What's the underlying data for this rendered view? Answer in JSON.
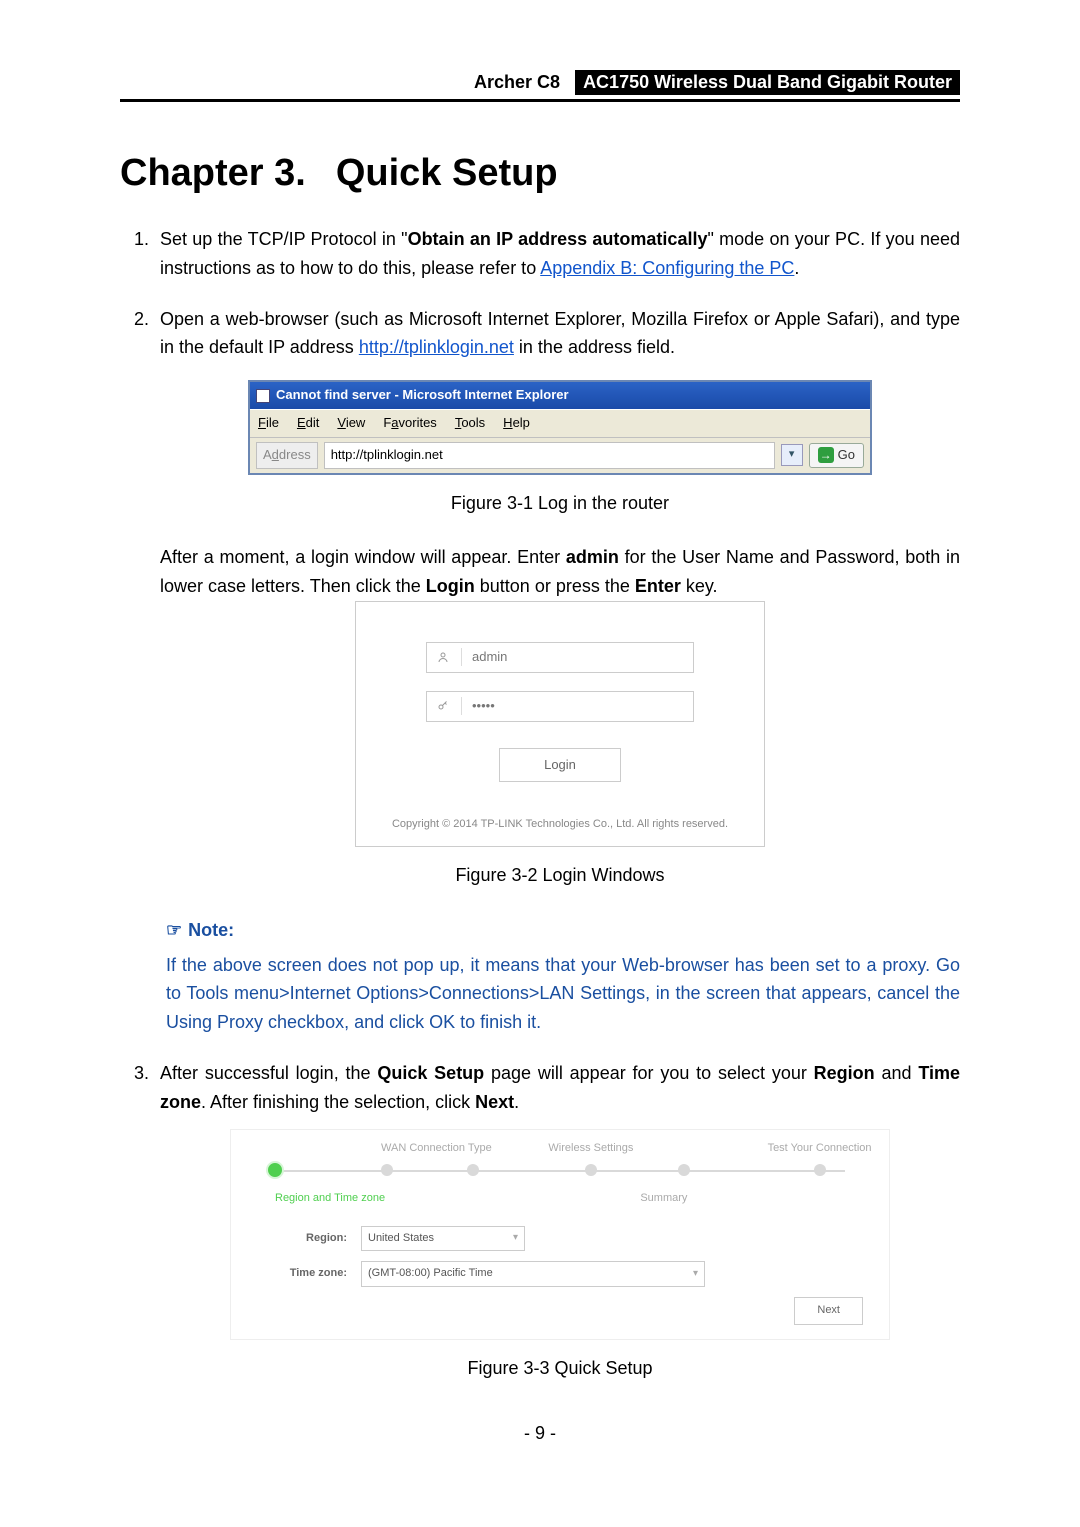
{
  "header": {
    "product_short": "Archer C8",
    "product_full": "AC1750 Wireless Dual Band Gigabit Router"
  },
  "chapter": {
    "prefix": "Chapter 3.",
    "title": "Quick Setup"
  },
  "steps": {
    "s1_a": "Set up the TCP/IP Protocol in \"",
    "s1_bold": "Obtain an IP address automatically",
    "s1_b": "\" mode on your PC. If you need instructions as to how to do this, please refer to ",
    "s1_link": "Appendix B: Configuring the PC",
    "s1_c": ".",
    "s2_a": "Open a web-browser (such as Microsoft Internet Explorer, Mozilla Firefox or Apple Safari), and type in the default IP address ",
    "s2_link": "http://tplinklogin.net",
    "s2_b": " in the address field.",
    "s3_a": "After successful login, the ",
    "s3_bold1": "Quick Setup",
    "s3_b": " page will appear for you to select your ",
    "s3_bold2": "Region",
    "s3_c": " and ",
    "s3_bold3": "Time zone",
    "s3_d": ". After finishing the selection, click ",
    "s3_bold4": "Next",
    "s3_e": "."
  },
  "ie": {
    "title": "Cannot find server - Microsoft Internet Explorer",
    "menu": {
      "file": "File",
      "edit": "Edit",
      "view": "View",
      "favorites": "Favorites",
      "tools": "Tools",
      "help": "Help"
    },
    "addr_label": "Address",
    "addr_value": "http://tplinklogin.net",
    "go": "Go"
  },
  "fig1": "Figure 3-1 Log in the router",
  "mid_para_a": "After a moment, a login window will appear. Enter ",
  "mid_bold1": "admin",
  "mid_para_b": " for the User Name and Password, both in lower case letters. Then click the ",
  "mid_bold2": "Login",
  "mid_para_c": " button or press the ",
  "mid_bold3": "Enter",
  "mid_para_d": " key.",
  "login": {
    "username": "admin",
    "password_mask": "•••••",
    "button": "Login",
    "copyright": "Copyright © 2014 TP-LINK Technologies Co., Ltd. All rights reserved."
  },
  "fig2": "Figure 3-2 Login Windows",
  "note": {
    "label": "Note:",
    "body": "If the above screen does not pop up, it means that your Web-browser has been set to a proxy. Go to Tools menu>Internet Options>Connections>LAN Settings, in the screen that appears, cancel the Using Proxy checkbox, and click OK to finish it."
  },
  "qs": {
    "labels": {
      "wan": "WAN Connection Type",
      "wireless": "Wireless Settings",
      "test": "Test Your Connection",
      "current": "Region and Time zone",
      "summary": "Summary"
    },
    "form": {
      "region_label": "Region:",
      "region_value": "United States",
      "tz_label": "Time zone:",
      "tz_value": "(GMT-08:00) Pacific Time"
    },
    "next": "Next"
  },
  "fig3": "Figure 3-3 Quick Setup",
  "page_number": "- 9 -"
}
